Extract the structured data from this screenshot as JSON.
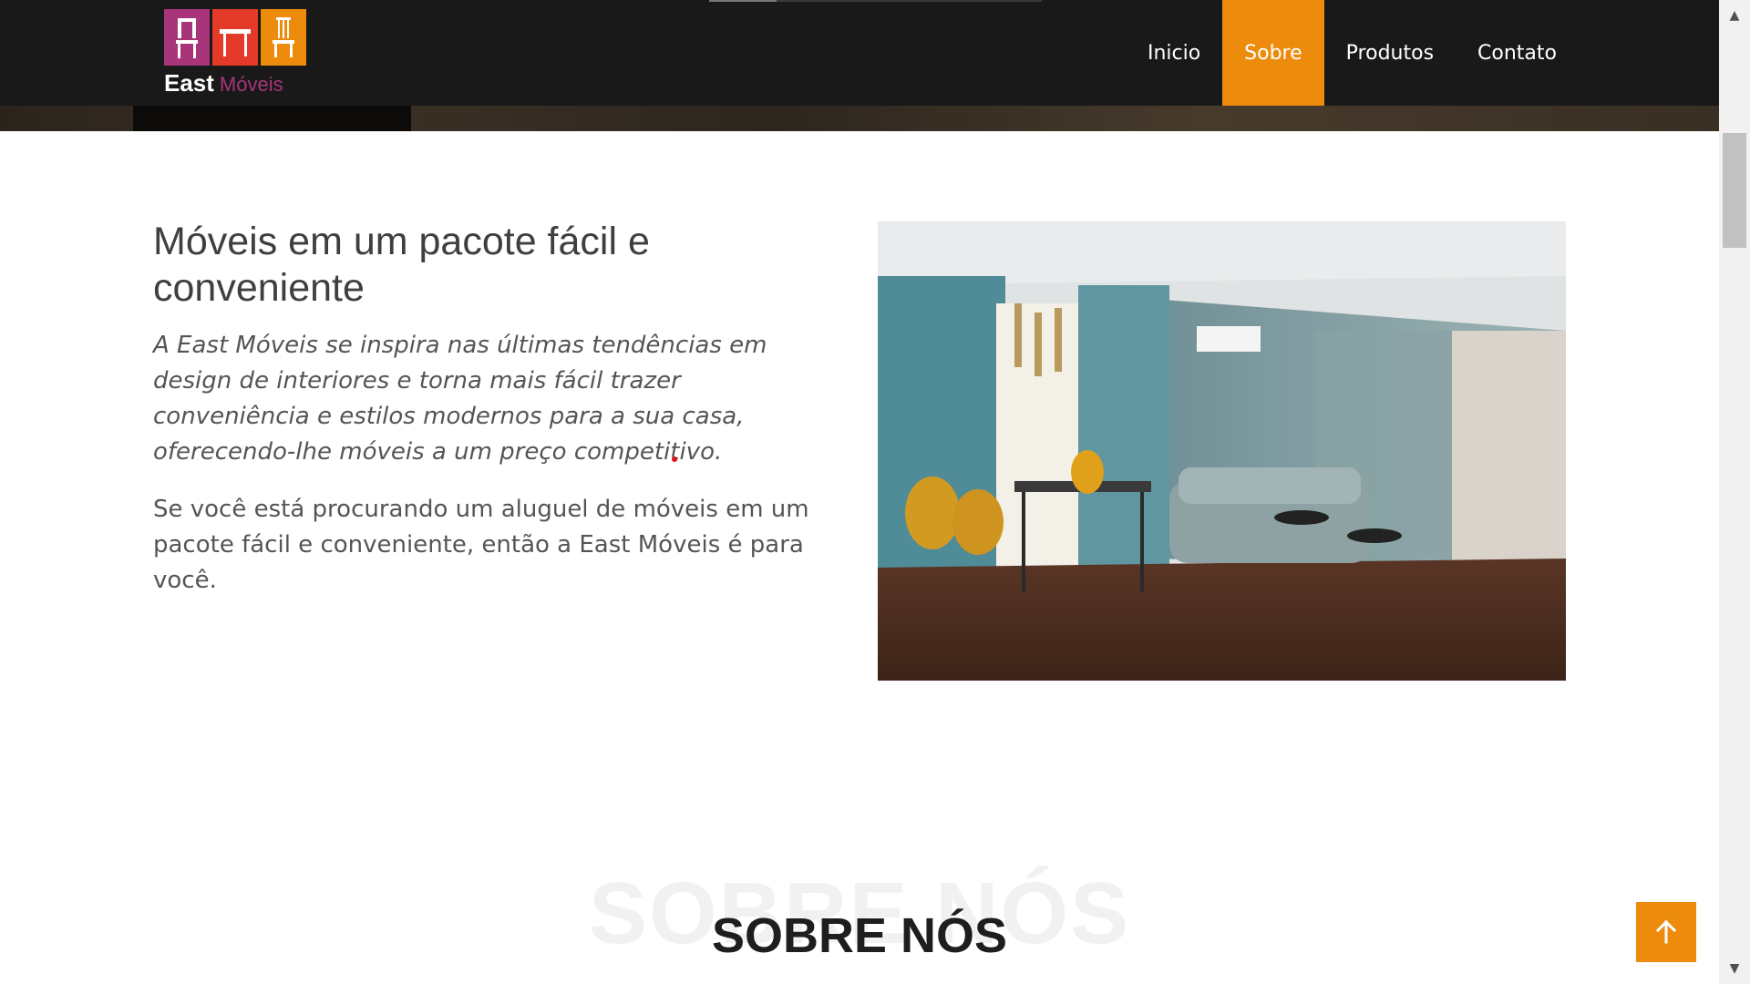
{
  "brand": {
    "name_part1": "East",
    "name_part2": "Móveis"
  },
  "nav": {
    "items": [
      {
        "label": "Inicio"
      },
      {
        "label": "Sobre"
      },
      {
        "label": "Produtos"
      },
      {
        "label": "Contato"
      }
    ],
    "active_index": 1
  },
  "content": {
    "heading": "Móveis em um pacote fácil e conveniente",
    "italic_paragraph": "A East Móveis se inspira nas últimas tendências em design de interiores e torna mais fácil trazer conveniência e estilos modernos para a sua casa, oferecendo-lhe móveis a um preço competitivo.",
    "paragraph": "Se você está procurando um aluguel de móveis em um pacote fácil e conveniente, então a East Móveis é para você."
  },
  "section": {
    "ghost_title": "SOBRE NÓS",
    "title": "SOBRE NÓS"
  },
  "colors": {
    "accent": "#ec8b0c",
    "header_bg": "#191919",
    "logo_magenta": "#a8357a",
    "logo_red": "#e33a2a"
  },
  "icons": {
    "back_to_top": "arrow-up-icon"
  }
}
